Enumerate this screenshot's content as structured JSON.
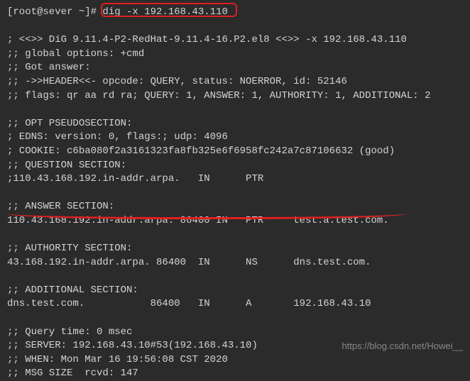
{
  "prompt": "[root@sever ~]# ",
  "command": "dig -x 192.168.43.110",
  "header1": "; <<>> DiG 9.11.4-P2-RedHat-9.11.4-16.P2.el8 <<>> -x 192.168.43.110",
  "header2": ";; global options: +cmd",
  "header3": ";; Got answer:",
  "header4": ";; ->>HEADER<<- opcode: QUERY, status: NOERROR, id: 52146",
  "header5": ";; flags: qr aa rd ra; QUERY: 1, ANSWER: 1, AUTHORITY: 1, ADDITIONAL: 2",
  "opt1": ";; OPT PSEUDOSECTION:",
  "opt2": "; EDNS: version: 0, flags:; udp: 4096",
  "opt3": "; COOKIE: c6ba080f2a3161323fa8fb325e6f6958fc242a7c87106632 (good)",
  "question1": ";; QUESTION SECTION:",
  "question2": ";110.43.168.192.in-addr.arpa.   IN      PTR",
  "answer1": ";; ANSWER SECTION:",
  "answer2": "110.43.168.192.in-addr.arpa. 86400 IN   PTR     test.a.test.com.",
  "authority1": ";; AUTHORITY SECTION:",
  "authority2": "43.168.192.in-addr.arpa. 86400  IN      NS      dns.test.com.",
  "additional1": ";; ADDITIONAL SECTION:",
  "additional2": "dns.test.com.           86400   IN      A       192.168.43.10",
  "footer1": ";; Query time: 0 msec",
  "footer2": ";; SERVER: 192.168.43.10#53(192.168.43.10)",
  "footer3": ";; WHEN: Mon Mar 16 19:56:08 CST 2020",
  "footer4": ";; MSG SIZE  rcvd: 147",
  "watermark": "https://blog.csdn.net/Howei__"
}
